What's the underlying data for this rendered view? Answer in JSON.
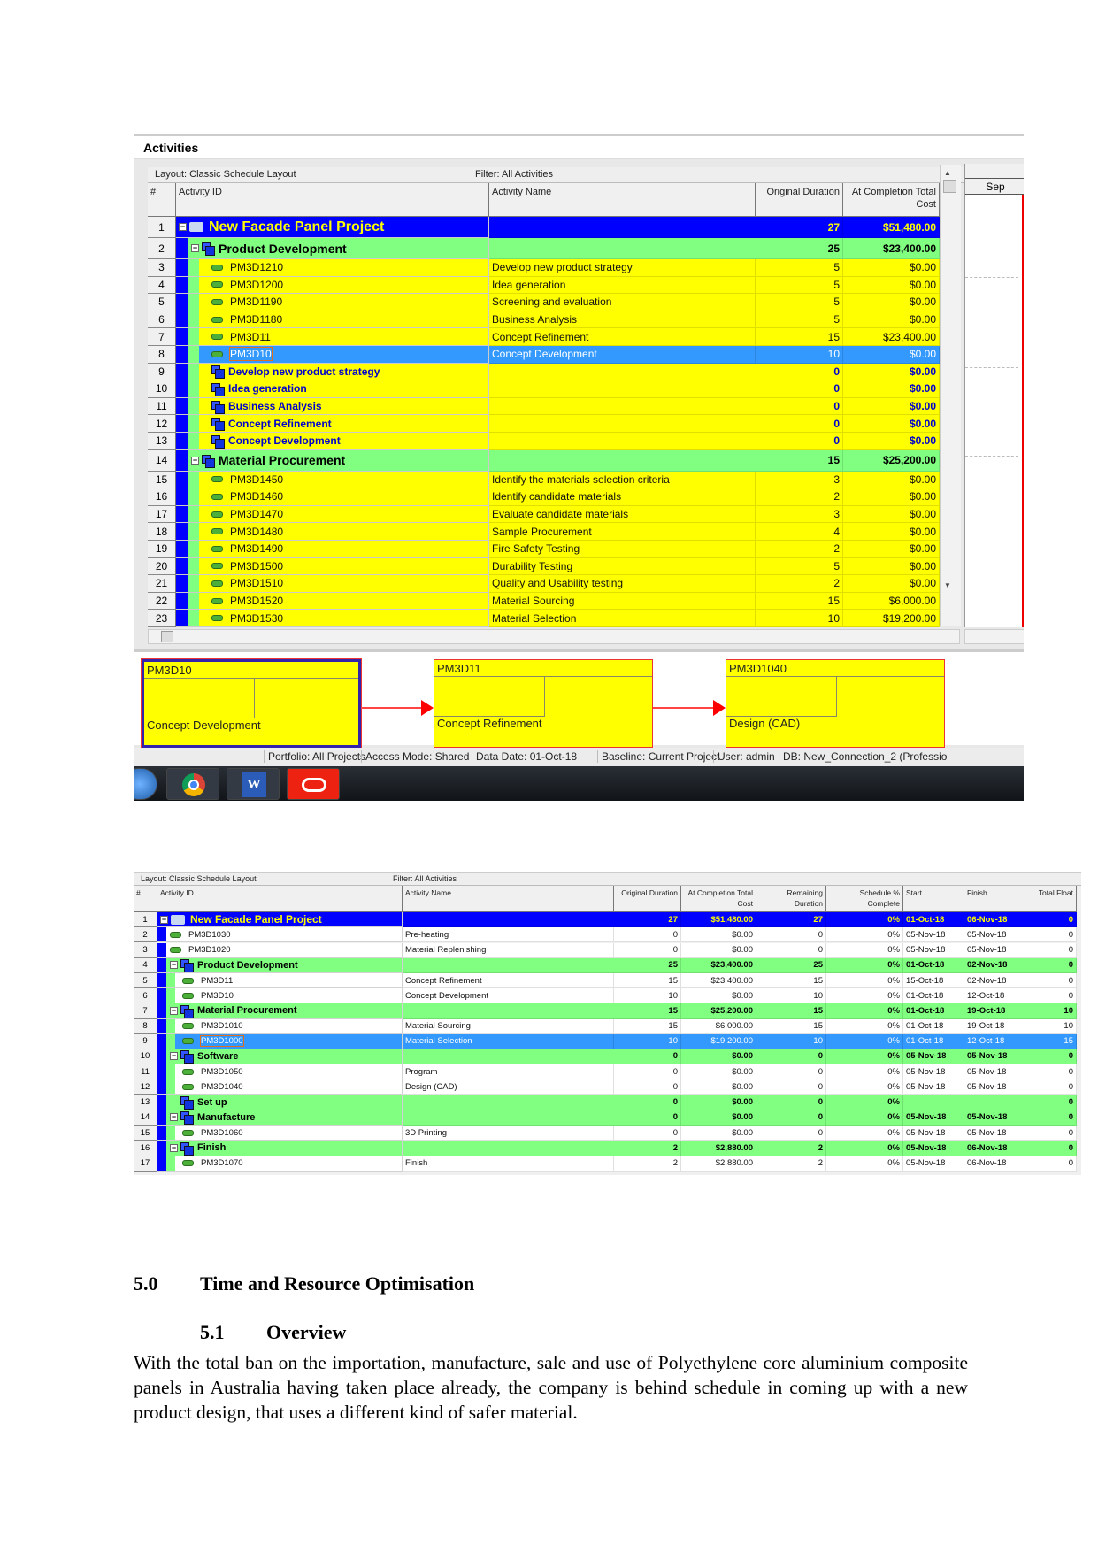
{
  "colors": {
    "project": "#0000ff",
    "wbs": "#80ff80",
    "activity": "#ffff00",
    "selected": "#3399ff"
  },
  "window1": {
    "title": "Activities",
    "layout": "Layout: Classic Schedule Layout",
    "filter": "Filter: All Activities",
    "headers": [
      "#",
      "Activity ID",
      "Activity Name",
      "Original Duration",
      "At Completion Total Cost"
    ],
    "gantt_header": "Sep",
    "rows": [
      {
        "n": "1",
        "type": "project",
        "id": "New Facade Panel Project",
        "name": "",
        "od": "27",
        "cost": "$51,480.00"
      },
      {
        "n": "2",
        "type": "wbs",
        "id": "Product Development",
        "name": "",
        "od": "25",
        "cost": "$23,400.00"
      },
      {
        "n": "3",
        "type": "act",
        "id": "PM3D1210",
        "name": "Develop new product strategy",
        "od": "5",
        "cost": "$0.00"
      },
      {
        "n": "4",
        "type": "act",
        "id": "PM3D1200",
        "name": "Idea generation",
        "od": "5",
        "cost": "$0.00"
      },
      {
        "n": "5",
        "type": "act",
        "id": "PM3D1190",
        "name": "Screening and evaluation",
        "od": "5",
        "cost": "$0.00"
      },
      {
        "n": "6",
        "type": "act",
        "id": "PM3D1180",
        "name": "Business Analysis",
        "od": "5",
        "cost": "$0.00"
      },
      {
        "n": "7",
        "type": "act",
        "id": "PM3D11",
        "name": "Concept Refinement",
        "od": "15",
        "cost": "$23,400.00"
      },
      {
        "n": "8",
        "type": "sel",
        "id": "PM3D10",
        "name": "Concept Development",
        "od": "10",
        "cost": "$0.00"
      },
      {
        "n": "9",
        "type": "wbsy",
        "id": "Develop new product strategy",
        "name": "",
        "od": "0",
        "cost": "$0.00"
      },
      {
        "n": "10",
        "type": "wbsy",
        "id": "Idea generation",
        "name": "",
        "od": "0",
        "cost": "$0.00"
      },
      {
        "n": "11",
        "type": "wbsy",
        "id": "Business Analysis",
        "name": "",
        "od": "0",
        "cost": "$0.00"
      },
      {
        "n": "12",
        "type": "wbsy",
        "id": "Concept Refinement",
        "name": "",
        "od": "0",
        "cost": "$0.00"
      },
      {
        "n": "13",
        "type": "wbsy",
        "id": "Concept Development",
        "name": "",
        "od": "0",
        "cost": "$0.00"
      },
      {
        "n": "14",
        "type": "wbs",
        "id": "Material Procurement",
        "name": "",
        "od": "15",
        "cost": "$25,200.00"
      },
      {
        "n": "15",
        "type": "act",
        "id": "PM3D1450",
        "name": "Identify the materials selection criteria",
        "od": "3",
        "cost": "$0.00"
      },
      {
        "n": "16",
        "type": "act",
        "id": "PM3D1460",
        "name": "Identify candidate materials",
        "od": "2",
        "cost": "$0.00"
      },
      {
        "n": "17",
        "type": "act",
        "id": "PM3D1470",
        "name": "Evaluate candidate materials",
        "od": "3",
        "cost": "$0.00"
      },
      {
        "n": "18",
        "type": "act",
        "id": "PM3D1480",
        "name": "Sample Procurement",
        "od": "4",
        "cost": "$0.00"
      },
      {
        "n": "19",
        "type": "act",
        "id": "PM3D1490",
        "name": "Fire Safety Testing",
        "od": "2",
        "cost": "$0.00"
      },
      {
        "n": "20",
        "type": "act",
        "id": "PM3D1500",
        "name": "Durability Testing",
        "od": "5",
        "cost": "$0.00"
      },
      {
        "n": "21",
        "type": "act",
        "id": "PM3D1510",
        "name": "Quality and Usability testing",
        "od": "2",
        "cost": "$0.00"
      },
      {
        "n": "22",
        "type": "act",
        "id": "PM3D1520",
        "name": "Material Sourcing",
        "od": "15",
        "cost": "$6,000.00"
      },
      {
        "n": "23",
        "type": "act",
        "id": "PM3D1530",
        "name": "Material Selection",
        "od": "10",
        "cost": "$19,200.00"
      }
    ],
    "network": [
      {
        "id": "PM3D10",
        "name": "Concept Development"
      },
      {
        "id": "PM3D11",
        "name": "Concept Refinement"
      },
      {
        "id": "PM3D1040",
        "name": "Design (CAD)"
      }
    ],
    "status": [
      "Portfolio: All Projects",
      "Access Mode: Shared",
      "Data Date: 01-Oct-18",
      "Baseline: Current Project",
      "User: admin",
      "DB: New_Connection_2 (Professio"
    ],
    "taskbar": [
      "start-icon",
      "chrome-icon",
      "word-icon",
      "oracle-icon"
    ]
  },
  "window2": {
    "layout": "Layout: Classic Schedule Layout",
    "filter": "Filter: All Activities",
    "headers": [
      "#",
      "Activity ID",
      "Activity Name",
      "Original Duration",
      "At Completion Total Cost",
      "Remaining Duration",
      "Schedule % Complete",
      "Start",
      "Finish",
      "Total Float"
    ],
    "rows": [
      {
        "n": "1",
        "type": "project",
        "lvl": 0,
        "id": "New Facade Panel Project",
        "name": "",
        "od": "27",
        "cost": "$51,480.00",
        "rd": "27",
        "pc": "0%",
        "start": "01-Oct-18",
        "finish": "06-Nov-18",
        "tf": "0"
      },
      {
        "n": "2",
        "type": "actw",
        "lvl": 1,
        "id": "PM3D1030",
        "name": "Pre-heating",
        "od": "0",
        "cost": "$0.00",
        "rd": "0",
        "pc": "0%",
        "start": "05-Nov-18",
        "finish": "05-Nov-18",
        "tf": "0"
      },
      {
        "n": "3",
        "type": "actw",
        "lvl": 1,
        "id": "PM3D1020",
        "name": "Material Replenishing",
        "od": "0",
        "cost": "$0.00",
        "rd": "0",
        "pc": "0%",
        "start": "05-Nov-18",
        "finish": "05-Nov-18",
        "tf": "0"
      },
      {
        "n": "4",
        "type": "wbs",
        "lvl": 1,
        "id": "Product Development",
        "name": "",
        "od": "25",
        "cost": "$23,400.00",
        "rd": "25",
        "pc": "0%",
        "start": "01-Oct-18",
        "finish": "02-Nov-18",
        "tf": "0"
      },
      {
        "n": "5",
        "type": "actw",
        "lvl": 2,
        "id": "PM3D11",
        "name": "Concept Refinement",
        "od": "15",
        "cost": "$23,400.00",
        "rd": "15",
        "pc": "0%",
        "start": "15-Oct-18",
        "finish": "02-Nov-18",
        "tf": "0"
      },
      {
        "n": "6",
        "type": "actw",
        "lvl": 2,
        "id": "PM3D10",
        "name": "Concept Development",
        "od": "10",
        "cost": "$0.00",
        "rd": "10",
        "pc": "0%",
        "start": "01-Oct-18",
        "finish": "12-Oct-18",
        "tf": "0"
      },
      {
        "n": "7",
        "type": "wbs",
        "lvl": 1,
        "id": "Material Procurement",
        "name": "",
        "od": "15",
        "cost": "$25,200.00",
        "rd": "15",
        "pc": "0%",
        "start": "01-Oct-18",
        "finish": "19-Oct-18",
        "tf": "10"
      },
      {
        "n": "8",
        "type": "actw",
        "lvl": 2,
        "id": "PM3D1010",
        "name": "Material Sourcing",
        "od": "15",
        "cost": "$6,000.00",
        "rd": "15",
        "pc": "0%",
        "start": "01-Oct-18",
        "finish": "19-Oct-18",
        "tf": "10"
      },
      {
        "n": "9",
        "type": "sel",
        "lvl": 2,
        "id": "PM3D1000",
        "name": "Material Selection",
        "od": "10",
        "cost": "$19,200.00",
        "rd": "10",
        "pc": "0%",
        "start": "01-Oct-18",
        "finish": "12-Oct-18",
        "tf": "15"
      },
      {
        "n": "10",
        "type": "wbs",
        "lvl": 1,
        "id": "Software",
        "name": "",
        "od": "0",
        "cost": "$0.00",
        "rd": "0",
        "pc": "0%",
        "start": "05-Nov-18",
        "finish": "05-Nov-18",
        "tf": "0"
      },
      {
        "n": "11",
        "type": "actw",
        "lvl": 2,
        "id": "PM3D1050",
        "name": "Program",
        "od": "0",
        "cost": "$0.00",
        "rd": "0",
        "pc": "0%",
        "start": "05-Nov-18",
        "finish": "05-Nov-18",
        "tf": "0"
      },
      {
        "n": "12",
        "type": "actw",
        "lvl": 2,
        "id": "PM3D1040",
        "name": "Design (CAD)",
        "od": "0",
        "cost": "$0.00",
        "rd": "0",
        "pc": "0%",
        "start": "05-Nov-18",
        "finish": "05-Nov-18",
        "tf": "0"
      },
      {
        "n": "13",
        "type": "wbs",
        "lvl": 1,
        "nofold": true,
        "id": "Set up",
        "name": "",
        "od": "0",
        "cost": "$0.00",
        "rd": "0",
        "pc": "0%",
        "start": "",
        "finish": "",
        "tf": "0"
      },
      {
        "n": "14",
        "type": "wbs",
        "lvl": 1,
        "id": "Manufacture",
        "name": "",
        "od": "0",
        "cost": "$0.00",
        "rd": "0",
        "pc": "0%",
        "start": "05-Nov-18",
        "finish": "05-Nov-18",
        "tf": "0"
      },
      {
        "n": "15",
        "type": "actw",
        "lvl": 2,
        "id": "PM3D1060",
        "name": "3D Printing",
        "od": "0",
        "cost": "$0.00",
        "rd": "0",
        "pc": "0%",
        "start": "05-Nov-18",
        "finish": "05-Nov-18",
        "tf": "0"
      },
      {
        "n": "16",
        "type": "wbs",
        "lvl": 1,
        "id": "Finish",
        "name": "",
        "od": "2",
        "cost": "$2,880.00",
        "rd": "2",
        "pc": "0%",
        "start": "05-Nov-18",
        "finish": "06-Nov-18",
        "tf": "0"
      },
      {
        "n": "17",
        "type": "actw",
        "lvl": 2,
        "id": "PM3D1070",
        "name": "Finish",
        "od": "2",
        "cost": "$2,880.00",
        "rd": "2",
        "pc": "0%",
        "start": "05-Nov-18",
        "finish": "06-Nov-18",
        "tf": "0"
      }
    ]
  },
  "doc": {
    "section_num": "5.0",
    "section_title": "Time and Resource Optimisation",
    "sub_num": "5.1",
    "sub_title": "Overview",
    "paragraph": "With the total ban on the importation, manufacture, sale and use of Polyethylene core aluminium composite panels in Australia having taken place already, the company is behind schedule in coming up with a new product design, that uses a different kind of safer material."
  }
}
